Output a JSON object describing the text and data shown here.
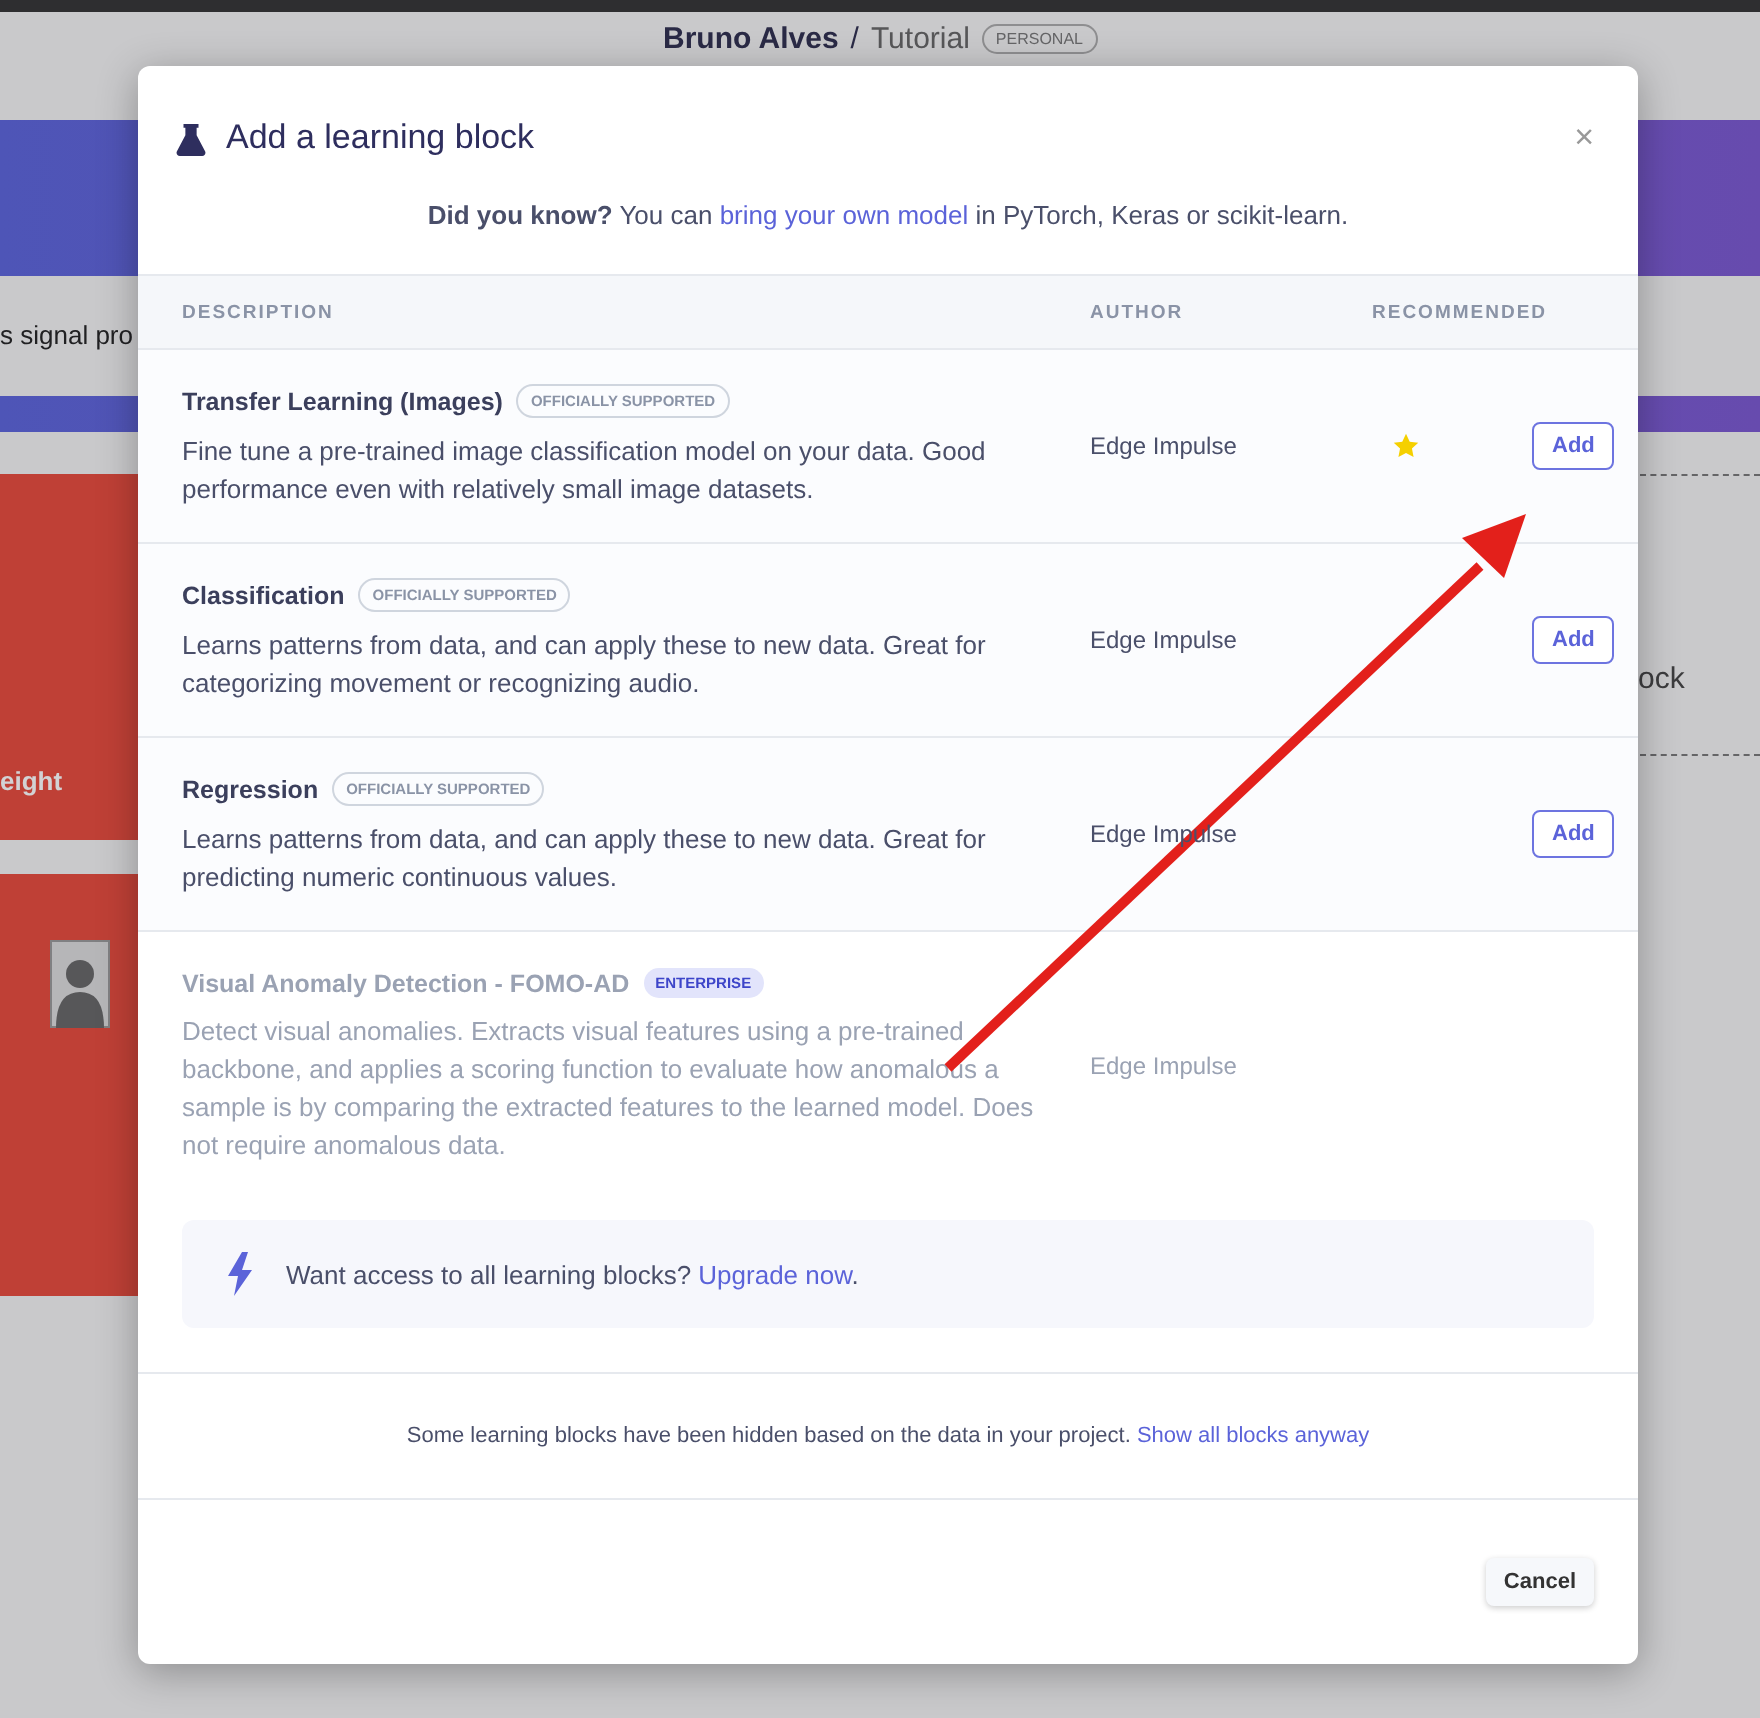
{
  "background": {
    "breadcrumb": {
      "owner": "Bruno Alves",
      "separator": "/",
      "project": "Tutorial",
      "badge": "PERSONAL"
    },
    "left_caption": "s signal pro",
    "card_label": "eight",
    "right_label": "ock"
  },
  "modal": {
    "title": "Add a learning block",
    "close": "×",
    "tip": "**Did you know?** You can ",
    "tip_link": "bring your own model",
    "tip_end": " in PyTorch, Keras or scikit-learn.",
    "columns": [
      "DESCRIPTION",
      "AUTHOR",
      "RECOMMENDED"
    ],
    "blocks": [
      {
        "name": "Transfer Learning (Images)",
        "badge": {
          "label": "OFFICIALLY SUPPORTED",
          "kind": "outline"
        },
        "description": "Fine tune a pre-trained image classification model on your data. Good performance even with relatively small image datasets.",
        "author": "Edge Impulse",
        "recommended": true,
        "disabled": false,
        "action": "Add"
      },
      {
        "name": "Classification",
        "badge": {
          "label": "OFFICIALLY SUPPORTED",
          "kind": "outline"
        },
        "description": "Learns patterns from data, and can apply these to new data. Great for categorizing movement or recognizing audio.",
        "author": "Edge Impulse",
        "recommended": false,
        "disabled": false,
        "action": "Add"
      },
      {
        "name": "Regression",
        "badge": {
          "label": "OFFICIALLY SUPPORTED",
          "kind": "outline"
        },
        "description": "Learns patterns from data, and can apply these to new data. Great for predicting numeric continuous values.",
        "author": "Edge Impulse",
        "recommended": false,
        "disabled": false,
        "action": "Add"
      },
      {
        "name": "Visual Anomaly Detection - FOMO-AD",
        "badge": {
          "label": "ENTERPRISE",
          "kind": "filled"
        },
        "description": "Detect visual anomalies. Extracts visual features using a pre-trained backbone, and applies a scoring function to evaluate how anomalous a sample is by comparing the extracted features to the learned model. Does not require anomalous data.",
        "author": "Edge Impulse",
        "recommended": false,
        "disabled": true
      }
    ],
    "upgrade": {
      "text": "Want access to all learning blocks? ",
      "link": "Upgrade now",
      "end": "."
    },
    "hidden_note": {
      "text": "Some learning blocks have been hidden based on the data in your project. ",
      "link": "Show all blocks anyway"
    },
    "cancel": "Cancel"
  }
}
